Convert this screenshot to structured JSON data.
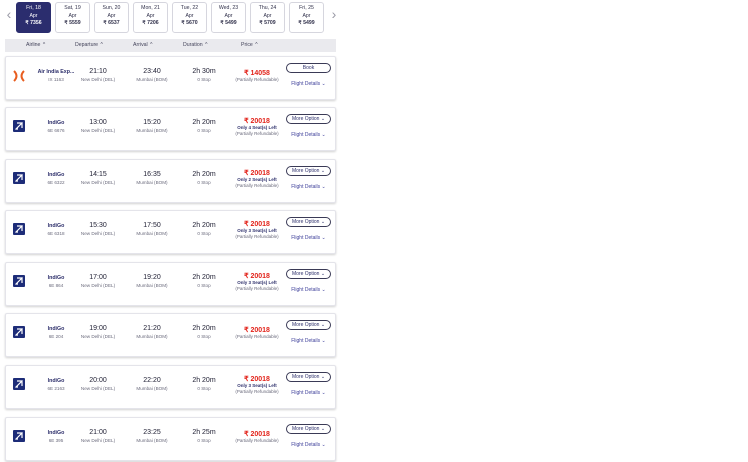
{
  "dates": [
    {
      "day": "Fri, 18",
      "month": "Apr",
      "price": "₹ 7356",
      "active": true
    },
    {
      "day": "Sat, 19",
      "month": "Apr",
      "price": "₹ 5559"
    },
    {
      "day": "Sun, 20",
      "month": "Apr",
      "price": "₹ 6537"
    },
    {
      "day": "Mon, 21",
      "month": "Apr",
      "price": "₹ 7206"
    },
    {
      "day": "Tue, 22",
      "month": "Apr",
      "price": "₹ 5670"
    },
    {
      "day": "Wed, 23",
      "month": "Apr",
      "price": "₹ 5499"
    },
    {
      "day": "Thu, 24",
      "month": "Apr",
      "price": "₹ 5709"
    },
    {
      "day": "Fri, 25",
      "month": "Apr",
      "price": "₹ 5499"
    }
  ],
  "nav": {
    "prev": "‹",
    "next": "›"
  },
  "headers": {
    "airline": "Airline",
    "departure": "Departure",
    "arrival": "Arrival",
    "duration": "Duration",
    "price": "Price",
    "caret": "^"
  },
  "flights": [
    {
      "airline": "Air India Exp...",
      "flight_no": "IX 1163",
      "logo": "air-india-express",
      "dep_time": "21:10",
      "dep_city": "New Delhi (DEL)",
      "arr_time": "23:40",
      "arr_city": "Mumbai (BOM)",
      "duration": "2h 30m",
      "stops": "0 Stop",
      "price": "₹ 14058",
      "seats": "",
      "refund": "(Partially Refundable)",
      "button": "Book",
      "details": "Flight Details ⌄"
    },
    {
      "airline": "IndiGo",
      "flight_no": "6E 6676",
      "logo": "indigo",
      "dep_time": "13:00",
      "dep_city": "New Delhi (DEL)",
      "arr_time": "15:20",
      "arr_city": "Mumbai (BOM)",
      "duration": "2h 20m",
      "stops": "0 Stop",
      "price": "₹ 20018",
      "seats": "Only 4 Seat(s) Left",
      "refund": "(Partially Refundable)",
      "button": "More Option ⌄",
      "details": "Flight Details ⌄"
    },
    {
      "airline": "IndiGo",
      "flight_no": "6E 6322",
      "logo": "indigo",
      "dep_time": "14:15",
      "dep_city": "New Delhi (DEL)",
      "arr_time": "16:35",
      "arr_city": "Mumbai (BOM)",
      "duration": "2h 20m",
      "stops": "0 Stop",
      "price": "₹ 20018",
      "seats": "Only 2 Seat(s) Left",
      "refund": "(Partially Refundable)",
      "button": "More Option ⌄",
      "details": "Flight Details ⌄"
    },
    {
      "airline": "IndiGo",
      "flight_no": "6E 6318",
      "logo": "indigo",
      "dep_time": "15:30",
      "dep_city": "New Delhi (DEL)",
      "arr_time": "17:50",
      "arr_city": "Mumbai (BOM)",
      "duration": "2h 20m",
      "stops": "0 Stop",
      "price": "₹ 20018",
      "seats": "Only 3 Seat(s) Left",
      "refund": "(Partially Refundable)",
      "button": "More Option ⌄",
      "details": "Flight Details ⌄"
    },
    {
      "airline": "IndiGo",
      "flight_no": "6E 864",
      "logo": "indigo",
      "dep_time": "17:00",
      "dep_city": "New Delhi (DEL)",
      "arr_time": "19:20",
      "arr_city": "Mumbai (BOM)",
      "duration": "2h 20m",
      "stops": "0 Stop",
      "price": "₹ 20018",
      "seats": "Only 3 Seat(s) Left",
      "refund": "(Partially Refundable)",
      "button": "More Option ⌄",
      "details": "Flight Details ⌄"
    },
    {
      "airline": "IndiGo",
      "flight_no": "6E 204",
      "logo": "indigo",
      "dep_time": "19:00",
      "dep_city": "New Delhi (DEL)",
      "arr_time": "21:20",
      "arr_city": "Mumbai (BOM)",
      "duration": "2h 20m",
      "stops": "0 Stop",
      "price": "₹ 20018",
      "seats": "",
      "refund": "(Partially Refundable)",
      "button": "More Option ⌄",
      "details": "Flight Details ⌄"
    },
    {
      "airline": "IndiGo",
      "flight_no": "6E 2163",
      "logo": "indigo",
      "dep_time": "20:00",
      "dep_city": "New Delhi (DEL)",
      "arr_time": "22:20",
      "arr_city": "Mumbai (BOM)",
      "duration": "2h 20m",
      "stops": "0 Stop",
      "price": "₹ 20018",
      "seats": "Only 3 Seat(s) Left",
      "refund": "(Partially Refundable)",
      "button": "More Option ⌄",
      "details": "Flight Details ⌄"
    },
    {
      "airline": "IndiGo",
      "flight_no": "6E 395",
      "logo": "indigo",
      "dep_time": "21:00",
      "dep_city": "New Delhi (DEL)",
      "arr_time": "23:25",
      "arr_city": "Mumbai (BOM)",
      "duration": "2h 25m",
      "stops": "0 Stop",
      "price": "₹ 20018",
      "seats": "",
      "refund": "(Partially Refundable)",
      "button": "More Option ⌄",
      "details": "Flight Details ⌄"
    }
  ],
  "colors": {
    "accent": "#2b2d6e",
    "price": "#e2231a",
    "air_india_express": "#e85d1f",
    "indigo": "#1d2c78"
  }
}
